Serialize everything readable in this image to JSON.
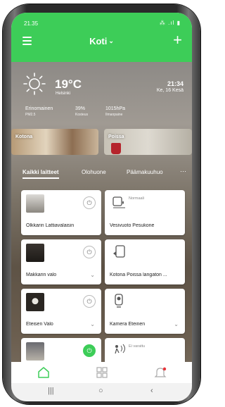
{
  "status_bar": {
    "time": "21.35",
    "icons": "⁂ .ıl ▮"
  },
  "header": {
    "title": "Koti",
    "chevron": "⌄",
    "add_label": "+"
  },
  "weather": {
    "temperature": "19°C",
    "city": "Helsinki",
    "clock": "21:34",
    "date": "Ke, 16 Kesä",
    "air_quality": {
      "value": "Erinomainen",
      "label": "PM2.5"
    },
    "humidity": {
      "value": "39%",
      "label": "Kosteus"
    },
    "pressure": {
      "value": "1015hPa",
      "label": "Ilmanpaine"
    }
  },
  "scenes": [
    {
      "label": "Kotona"
    },
    {
      "label": "Poissa"
    }
  ],
  "tabs": {
    "items": [
      "Kaikki laitteet",
      "Olohuone",
      "Päämakuuhuo"
    ],
    "more": "⋯"
  },
  "devices": [
    {
      "name": "Olkkarin Lattiavalaisin",
      "status": ""
    },
    {
      "name": "Vesivuoto Pesukone",
      "status": "Normaali"
    },
    {
      "name": "Makkarin valo",
      "status": ""
    },
    {
      "name": "Kotona Poissa langaton ...",
      "status": ""
    },
    {
      "name": "Eteisen Valo",
      "status": ""
    },
    {
      "name": "Kamera Eteinen",
      "status": ""
    },
    {
      "name": "",
      "status": ""
    },
    {
      "name": "",
      "status": "Ei varattu"
    }
  ],
  "icons": {
    "menu": "menu-icon",
    "add": "plus-icon",
    "weather": "sun-icon",
    "power": "power-icon",
    "home": "home-icon",
    "devices": "grid-icon",
    "notifications": "bell-icon"
  },
  "colors": {
    "accent": "#3dcd58",
    "text": "#222222"
  },
  "system_nav": {
    "recents": "|||",
    "home": "○",
    "back": "‹"
  }
}
